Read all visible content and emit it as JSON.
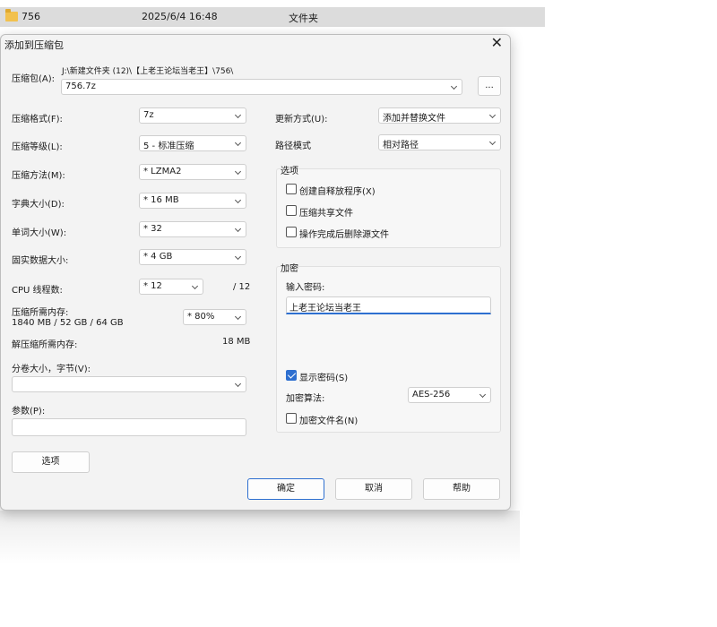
{
  "explorer": {
    "name": "756",
    "date": "2025/6/4 16:48",
    "type": "文件夹"
  },
  "dialog": {
    "title": "添加到压缩包",
    "archive": {
      "label": "压缩包(A):",
      "path": "J:\\新建文件夹 (12)\\【上老王论坛当老王】\\756\\",
      "filename": "756.7z",
      "browse_label": "..."
    },
    "left": {
      "format_label": "压缩格式(F):",
      "format_value": "7z",
      "level_label": "压缩等级(L):",
      "level_value": "5 - 标准压缩",
      "method_label": "压缩方法(M):",
      "method_value": "* LZMA2",
      "dict_label": "字典大小(D):",
      "dict_value": "* 16 MB",
      "word_label": "单词大小(W):",
      "word_value": "* 32",
      "solid_label": "固实数据大小:",
      "solid_value": "* 4 GB",
      "threads_label": "CPU 线程数:",
      "threads_value": "* 12",
      "threads_total": "/ 12",
      "mem_label": "压缩所需内存:",
      "mem_detail": "1840 MB / 52 GB / 64 GB",
      "mem_value": "* 80%",
      "decomp_label": "解压缩所需内存:",
      "decomp_value": "18 MB",
      "split_label": "分卷大小，字节(V):",
      "split_value": "",
      "params_label": "参数(P):",
      "params_value": "",
      "options_button": "选项"
    },
    "right": {
      "update_label": "更新方式(U):",
      "update_value": "添加并替换文件",
      "path_label": "路径模式",
      "path_value": "相对路径",
      "options_group": "选项",
      "opt_sfx": "创建自释放程序(X)",
      "opt_sfx_checked": false,
      "opt_shared": "压缩共享文件",
      "opt_shared_checked": false,
      "opt_delete": "操作完成后删除源文件",
      "opt_delete_checked": false,
      "encrypt_group": "加密",
      "password_label": "输入密码:",
      "password_value": "上老王论坛当老王",
      "show_pwd": "显示密码(S)",
      "show_pwd_checked": true,
      "enc_method_label": "加密算法:",
      "enc_method_value": "AES-256",
      "enc_names": "加密文件名(N)",
      "enc_names_checked": false
    },
    "buttons": {
      "ok": "确定",
      "cancel": "取消",
      "help": "帮助"
    }
  },
  "colors": {
    "accent": "#2e6fd0",
    "dialog_bg": "#f3f3f3",
    "row_highlight": "#dcdcdc"
  }
}
